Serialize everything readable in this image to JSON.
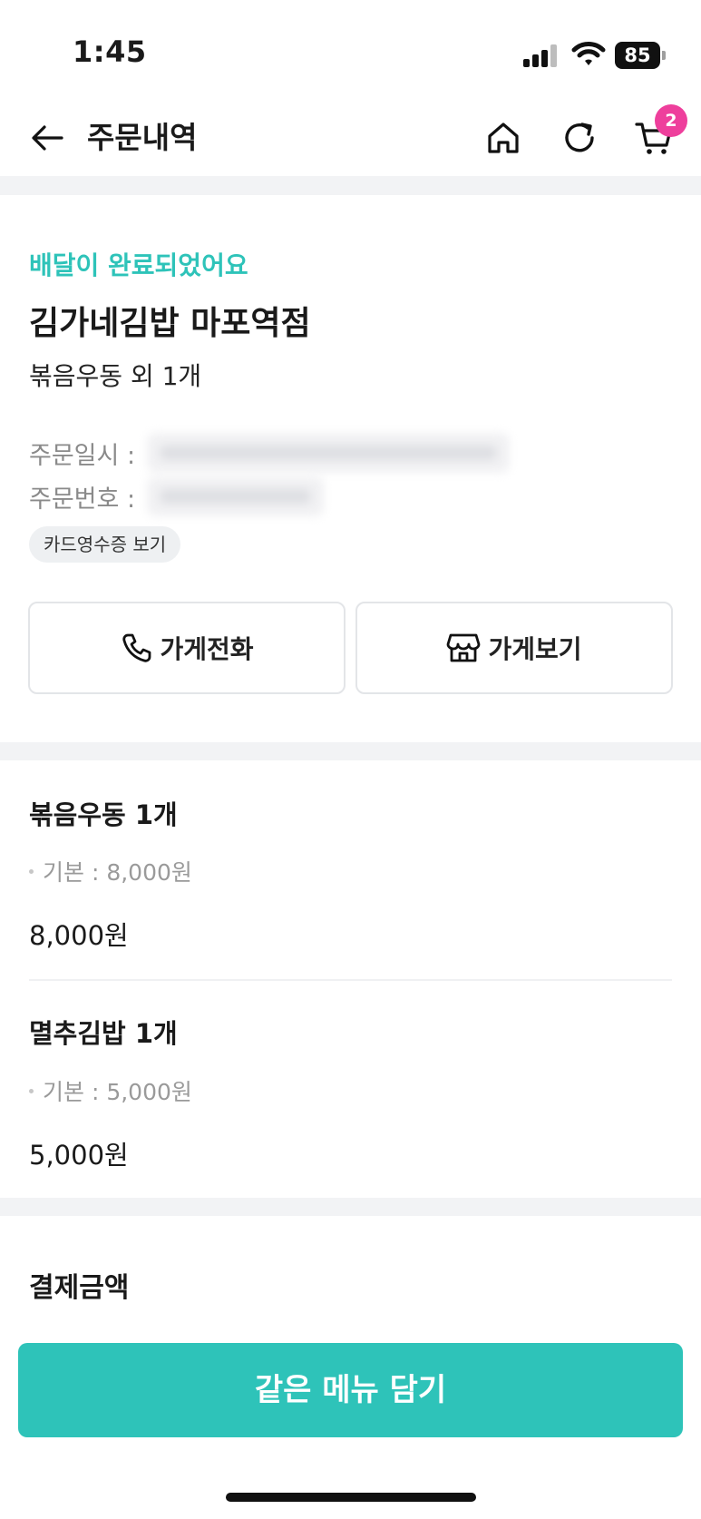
{
  "status_bar": {
    "time": "1:45",
    "battery": "85"
  },
  "nav": {
    "title": "주문내역",
    "cart_badge": "2",
    "icons": [
      "arrow-left-icon",
      "home-icon",
      "refresh-icon",
      "cart-icon"
    ]
  },
  "order": {
    "status_message": "배달이 완료되었어요",
    "store_name": "김가네김밥 마포역점",
    "menu_summary": "볶음우동 외 1개",
    "order_date_label": "주문일시 :",
    "order_number_label": "주문번호 :",
    "receipt_link": "카드영수증 보기",
    "call_store": "가게전화",
    "view_store": "가게보기"
  },
  "items": [
    {
      "name": "볶음우동 1개",
      "option": "기본 : 8,000원",
      "price": "8,000원"
    },
    {
      "name": "멸추김밥 1개",
      "option": "기본 : 5,000원",
      "price": "5,000원"
    }
  ],
  "payment": {
    "title": "결제금액"
  },
  "cta": {
    "label": "같은 메뉴 담기"
  },
  "colors": {
    "accent": "#2ec3b9",
    "badge": "#ee3f9c",
    "band": "#f2f3f5"
  }
}
